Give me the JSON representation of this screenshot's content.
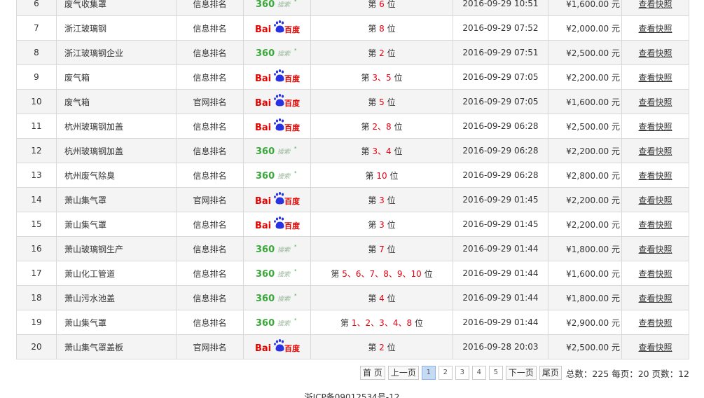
{
  "rows": [
    {
      "no": "6",
      "kw": "废气收集罩",
      "type": "信息排名",
      "engine": "360",
      "rank": [
        [
          "第 ",
          "n"
        ],
        [
          "6",
          "r"
        ],
        [
          " 位",
          "n"
        ]
      ],
      "date": "2016-09-29 10:51",
      "price": "¥1,600.00 元",
      "link": "查看快照"
    },
    {
      "no": "7",
      "kw": "浙江玻璃钢",
      "type": "信息排名",
      "engine": "baidu",
      "rank": [
        [
          "第 ",
          "n"
        ],
        [
          "8",
          "r"
        ],
        [
          " 位",
          "n"
        ]
      ],
      "date": "2016-09-29 07:52",
      "price": "¥2,000.00 元",
      "link": "查看快照"
    },
    {
      "no": "8",
      "kw": "浙江玻璃钢企业",
      "type": "信息排名",
      "engine": "360",
      "rank": [
        [
          "第 ",
          "n"
        ],
        [
          "2",
          "r"
        ],
        [
          " 位",
          "n"
        ]
      ],
      "date": "2016-09-29 07:51",
      "price": "¥2,500.00 元",
      "link": "查看快照"
    },
    {
      "no": "9",
      "kw": "废气箱",
      "type": "信息排名",
      "engine": "baidu",
      "rank": [
        [
          "第 ",
          "n"
        ],
        [
          "3",
          "r"
        ],
        [
          "、",
          "r"
        ],
        [
          "5",
          "r"
        ],
        [
          " 位",
          "n"
        ]
      ],
      "date": "2016-09-29 07:05",
      "price": "¥2,200.00 元",
      "link": "查看快照"
    },
    {
      "no": "10",
      "kw": "废气箱",
      "type": "官网排名",
      "engine": "baidu",
      "rank": [
        [
          "第 ",
          "n"
        ],
        [
          "5",
          "r"
        ],
        [
          " 位",
          "n"
        ]
      ],
      "date": "2016-09-29 07:05",
      "price": "¥1,600.00 元",
      "link": "查看快照"
    },
    {
      "no": "11",
      "kw": "杭州玻璃钢加盖",
      "type": "信息排名",
      "engine": "baidu",
      "rank": [
        [
          "第 ",
          "n"
        ],
        [
          "2",
          "r"
        ],
        [
          "、",
          "r"
        ],
        [
          "8",
          "r"
        ],
        [
          " 位",
          "n"
        ]
      ],
      "date": "2016-09-29 06:28",
      "price": "¥2,500.00 元",
      "link": "查看快照"
    },
    {
      "no": "12",
      "kw": "杭州玻璃钢加盖",
      "type": "信息排名",
      "engine": "360",
      "rank": [
        [
          "第 ",
          "n"
        ],
        [
          "3",
          "r"
        ],
        [
          "、",
          "r"
        ],
        [
          "4",
          "r"
        ],
        [
          " 位",
          "n"
        ]
      ],
      "date": "2016-09-29 06:28",
      "price": "¥2,200.00 元",
      "link": "查看快照"
    },
    {
      "no": "13",
      "kw": "杭州废气除臭",
      "type": "信息排名",
      "engine": "360",
      "rank": [
        [
          "第 ",
          "n"
        ],
        [
          "10",
          "r"
        ],
        [
          " 位",
          "n"
        ]
      ],
      "date": "2016-09-29 06:28",
      "price": "¥2,800.00 元",
      "link": "查看快照"
    },
    {
      "no": "14",
      "kw": "萧山集气罩",
      "type": "官网排名",
      "engine": "baidu",
      "rank": [
        [
          "第 ",
          "n"
        ],
        [
          "3",
          "r"
        ],
        [
          " 位",
          "n"
        ]
      ],
      "date": "2016-09-29 01:45",
      "price": "¥2,200.00 元",
      "link": "查看快照"
    },
    {
      "no": "15",
      "kw": "萧山集气罩",
      "type": "信息排名",
      "engine": "baidu",
      "rank": [
        [
          "第 ",
          "n"
        ],
        [
          "3",
          "r"
        ],
        [
          " 位",
          "n"
        ]
      ],
      "date": "2016-09-29 01:45",
      "price": "¥2,200.00 元",
      "link": "查看快照"
    },
    {
      "no": "16",
      "kw": "萧山玻璃钢生产",
      "type": "信息排名",
      "engine": "360",
      "rank": [
        [
          "第 ",
          "n"
        ],
        [
          "7",
          "r"
        ],
        [
          " 位",
          "n"
        ]
      ],
      "date": "2016-09-29 01:44",
      "price": "¥1,800.00 元",
      "link": "查看快照"
    },
    {
      "no": "17",
      "kw": "萧山化工管道",
      "type": "信息排名",
      "engine": "360",
      "rank": [
        [
          "第 ",
          "n"
        ],
        [
          "5",
          "r"
        ],
        [
          "、",
          "r"
        ],
        [
          "6",
          "r"
        ],
        [
          "、",
          "r"
        ],
        [
          "7",
          "r"
        ],
        [
          "、",
          "r"
        ],
        [
          "8",
          "r"
        ],
        [
          "、",
          "r"
        ],
        [
          "9",
          "r"
        ],
        [
          "、",
          "r"
        ],
        [
          "10",
          "r"
        ],
        [
          " 位",
          "n"
        ]
      ],
      "date": "2016-09-29 01:44",
      "price": "¥1,600.00 元",
      "link": "查看快照"
    },
    {
      "no": "18",
      "kw": "萧山污水池盖",
      "type": "信息排名",
      "engine": "360",
      "rank": [
        [
          "第 ",
          "n"
        ],
        [
          "4",
          "r"
        ],
        [
          " 位",
          "n"
        ]
      ],
      "date": "2016-09-29 01:44",
      "price": "¥1,800.00 元",
      "link": "查看快照"
    },
    {
      "no": "19",
      "kw": "萧山集气罩",
      "type": "信息排名",
      "engine": "360",
      "rank": [
        [
          "第 ",
          "n"
        ],
        [
          "1",
          "r"
        ],
        [
          "、",
          "r"
        ],
        [
          "2",
          "r"
        ],
        [
          "、",
          "r"
        ],
        [
          "3",
          "r"
        ],
        [
          "、",
          "r"
        ],
        [
          "4",
          "r"
        ],
        [
          "、",
          "r"
        ],
        [
          "8",
          "r"
        ],
        [
          " 位",
          "n"
        ]
      ],
      "date": "2016-09-29 01:44",
      "price": "¥2,900.00 元",
      "link": "查看快照"
    },
    {
      "no": "20",
      "kw": "萧山集气罩盖板",
      "type": "官网排名",
      "engine": "baidu",
      "rank": [
        [
          "第 ",
          "n"
        ],
        [
          "2",
          "r"
        ],
        [
          " 位",
          "n"
        ]
      ],
      "date": "2016-09-28 20:03",
      "price": "¥2,500.00 元",
      "link": "查看快照"
    }
  ],
  "engines": {
    "360": {
      "big": "360",
      "small": "搜索",
      "icon": "360-search-logo-icon"
    },
    "baidu": {
      "bai": "Bai",
      "du": "百度",
      "icon": "baidu-logo-icon"
    }
  },
  "pagination": {
    "first": "首 页",
    "prev": "上一页",
    "pages": [
      "1",
      "2",
      "3",
      "4",
      "5"
    ],
    "current": "1",
    "next": "下一页",
    "last": "尾页",
    "info": "总数：225 每页：20 页数：12"
  },
  "footer": {
    "icp": "浙ICP备09012534号-12"
  },
  "colors": {
    "red": "#e60012",
    "border": "#d9d9d9",
    "row_even": "#f4f4f4",
    "green_360": "#3aa83a",
    "baidu_red": "#e10602",
    "baidu_blue": "#2932e1"
  }
}
